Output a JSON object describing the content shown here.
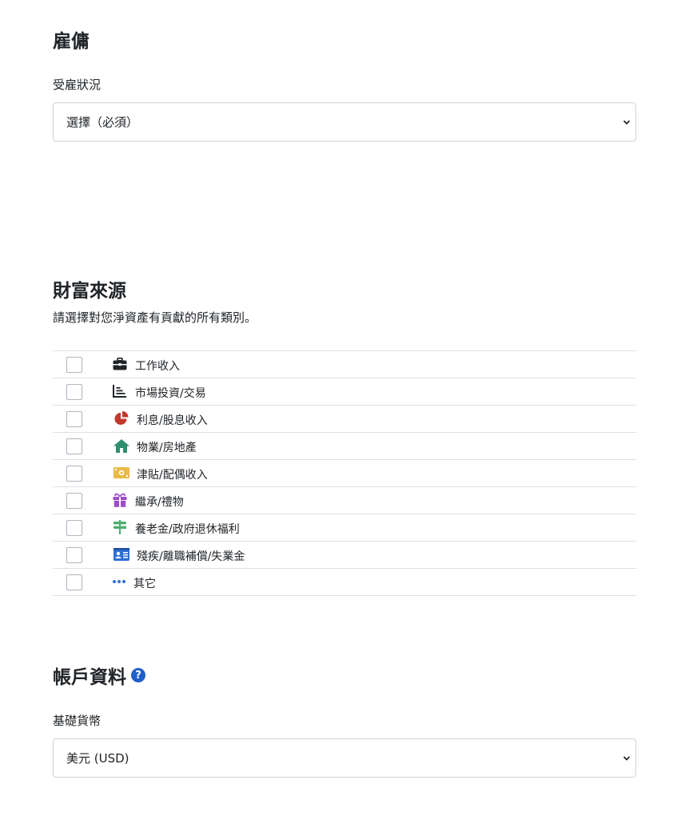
{
  "employment": {
    "title": "雇傭",
    "status_label": "受雇狀況",
    "status_value": "選擇（必須）"
  },
  "wealth": {
    "title": "財富來源",
    "description": "請選擇對您淨資產有貢獻的所有類別。",
    "items": [
      {
        "label": "工作收入",
        "icon": "briefcase-icon",
        "color": "#212529"
      },
      {
        "label": "市場投資/交易",
        "icon": "chart-bar-icon",
        "color": "#212529"
      },
      {
        "label": "利息/股息收入",
        "icon": "pie-chart-icon",
        "color": "#c0392b"
      },
      {
        "label": "物業/房地產",
        "icon": "house-icon",
        "color": "#2f8f6f"
      },
      {
        "label": "津貼/配偶收入",
        "icon": "money-bill-icon",
        "color": "#e9b949"
      },
      {
        "label": "繼承/禮物",
        "icon": "gift-icon",
        "color": "#9b4dca"
      },
      {
        "label": "養老金/政府退休福利",
        "icon": "signpost-icon",
        "color": "#4caf6e"
      },
      {
        "label": "殘疾/離職補償/失業金",
        "icon": "id-card-icon",
        "color": "#2f6fd6"
      },
      {
        "label": "其它",
        "icon": "ellipsis-icon",
        "color": "#2f6fd6"
      }
    ]
  },
  "account": {
    "title": "帳戶資料",
    "help_icon": "?",
    "currency_label": "基礎貨幣",
    "currency_value": "美元 (USD)"
  }
}
